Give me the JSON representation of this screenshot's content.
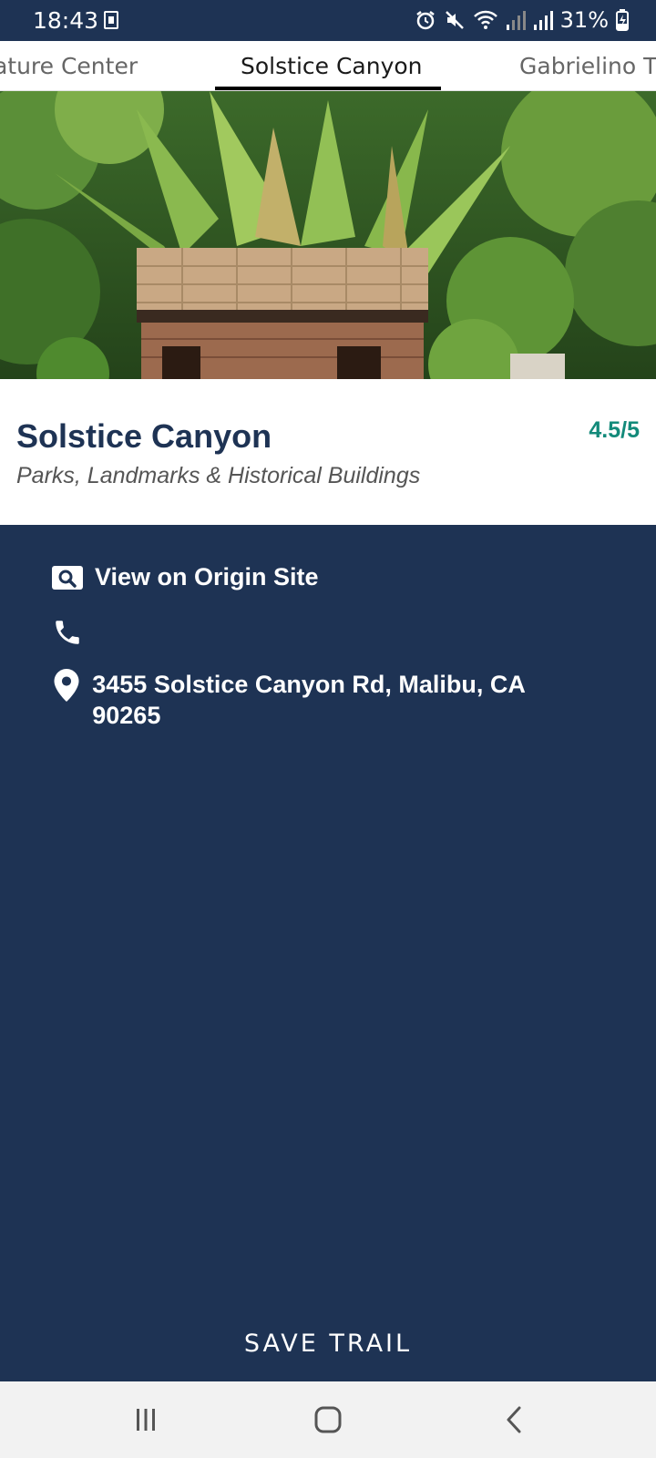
{
  "status_bar": {
    "time": "18:43",
    "battery": "31%",
    "icons": [
      "sim-card-icon",
      "alarm-icon",
      "mute-icon",
      "wifi-icon",
      "signal-icon",
      "signal-icon",
      "battery-charging-icon"
    ]
  },
  "tabs": [
    {
      "label": "lature Center"
    },
    {
      "label": "Solstice Canyon",
      "selected": true
    },
    {
      "label": "Gabrielino Tr"
    }
  ],
  "place": {
    "title": "Solstice Canyon",
    "category": "Parks, Landmarks & Historical Buildings",
    "rating": "4.5/5"
  },
  "details": {
    "website_label": "View on Origin Site",
    "phone": "",
    "address": "3455 Solstice Canyon Rd, Malibu, CA 90265"
  },
  "actions": {
    "save_label": "SAVE TRAIL"
  },
  "colors": {
    "primary_navy": "#1e3354",
    "rating_teal": "#138a7a"
  }
}
